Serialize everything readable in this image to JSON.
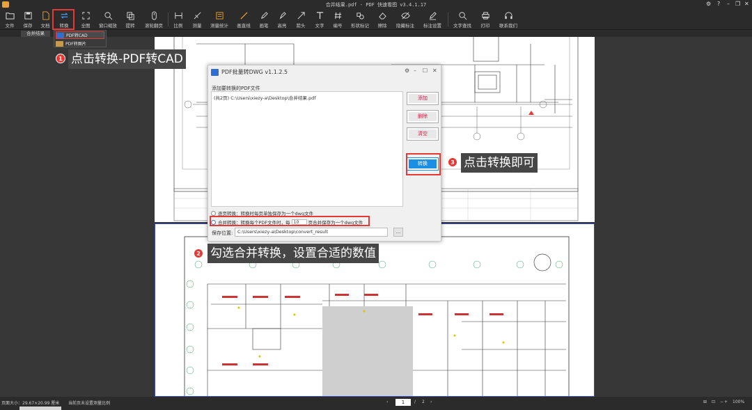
{
  "window": {
    "title": "合并结果.pdf - PDF 快速看图 v3.4.1.17"
  },
  "toolbar": {
    "items": [
      {
        "name": "file",
        "label": "文件"
      },
      {
        "name": "save",
        "label": "保存"
      },
      {
        "name": "doc",
        "label": "文档"
      },
      {
        "name": "convert",
        "label": "转换"
      },
      {
        "name": "fullscreen",
        "label": "全图"
      },
      {
        "name": "window-zoom",
        "label": "窗口缩放"
      },
      {
        "name": "copy",
        "label": "提转"
      },
      {
        "name": "mouse-page",
        "label": "滚轮翻页"
      },
      {
        "name": "scale",
        "label": "比例"
      },
      {
        "name": "measure",
        "label": "测量"
      },
      {
        "name": "measure-stats",
        "label": "测量统计"
      },
      {
        "name": "line",
        "label": "画直线"
      },
      {
        "name": "pen",
        "label": "画笔"
      },
      {
        "name": "highlight",
        "label": "高亮"
      },
      {
        "name": "arrow",
        "label": "箭头"
      },
      {
        "name": "text",
        "label": "文字"
      },
      {
        "name": "number",
        "label": "编号"
      },
      {
        "name": "shape-mark",
        "label": "形状标记"
      },
      {
        "name": "erase",
        "label": "擦除"
      },
      {
        "name": "hide-mark",
        "label": "隐藏标注"
      },
      {
        "name": "mark-settings",
        "label": "标注设置"
      },
      {
        "name": "find-text",
        "label": "文字查找"
      },
      {
        "name": "print",
        "label": "打印"
      },
      {
        "name": "contact",
        "label": "联系我们"
      }
    ]
  },
  "tab": {
    "label": "合并结果"
  },
  "dropdown": {
    "items": [
      "PDF转CAD",
      "PDF转图片"
    ]
  },
  "annotations": [
    {
      "num": "1",
      "text": "点击转换-PDF转CAD"
    },
    {
      "num": "2",
      "text": "勾选合并转换，设置合适的数值"
    },
    {
      "num": "3",
      "text": "点击转换即可"
    }
  ],
  "dialog": {
    "title": "PDF批量转DWG v1.1.2.5",
    "add_label": "添加要转换的PDF文件",
    "file_entry": "(共2页) C:\\Users\\xiezy-a\\Desktop\\合并结果.pdf",
    "buttons": {
      "add": "添加",
      "delete": "删除",
      "clear": "清空",
      "convert": "转换"
    },
    "opt_single": "逐页转换：转换时每页单独保存为一个dwg文件",
    "opt_merge_a": "合并转换：转换每个PDF文件时，每",
    "merge_pages": "10",
    "opt_merge_b": "页合并保存为一个dwg文件",
    "save_label": "保存位置:",
    "save_path": "C:\\Users\\xiezy-a\\Desktop\\convert_result",
    "browse": "..."
  },
  "status": {
    "page_size": "页面大小：29.67×20.99 厘米",
    "scale_hint": "当前页未设置测量比例",
    "current_page": "1",
    "total_pages": "2",
    "zoom": "100%"
  },
  "colors": {
    "accent": "#e53935",
    "primary_button": "#1a8fe3",
    "background": "#373737"
  }
}
